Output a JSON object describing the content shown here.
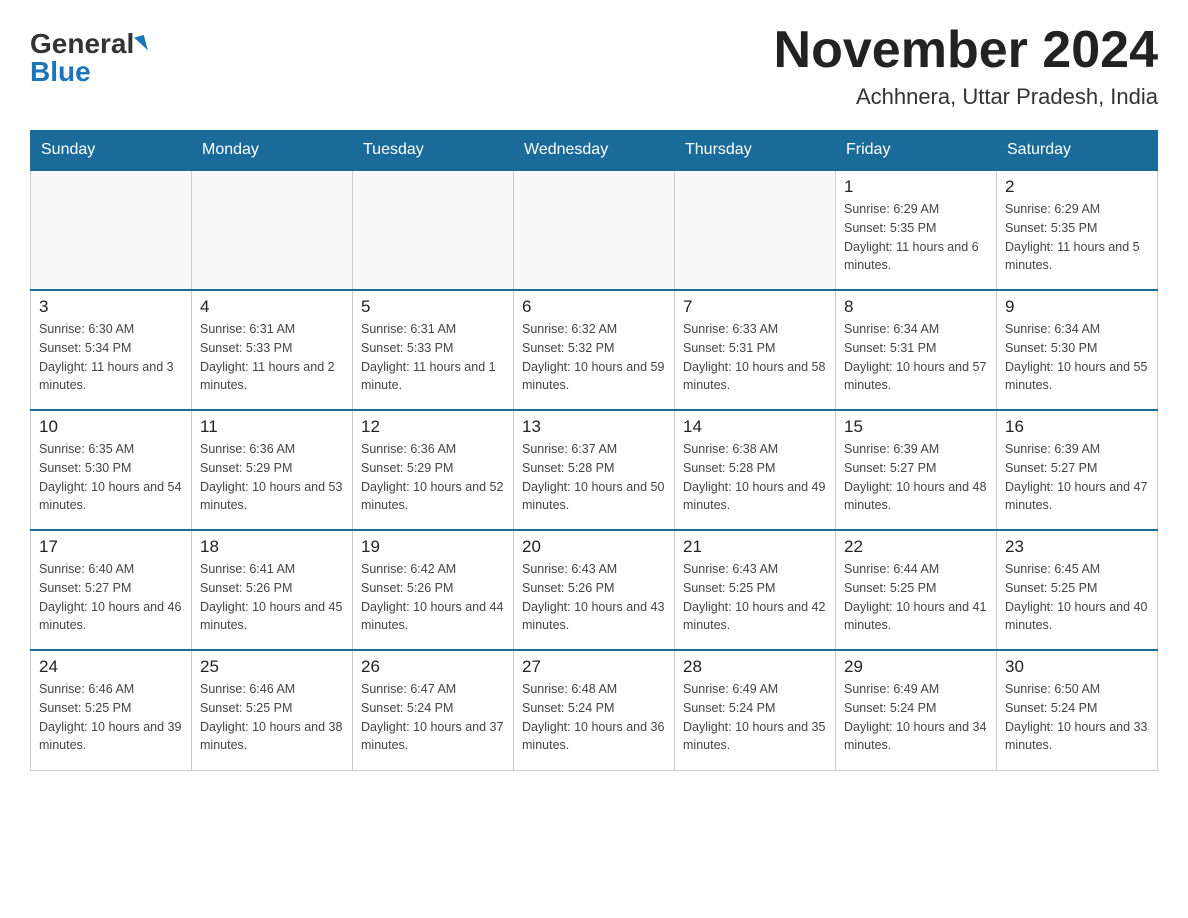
{
  "header": {
    "logo_general": "General",
    "logo_blue": "Blue",
    "month_title": "November 2024",
    "subtitle": "Achhnera, Uttar Pradesh, India"
  },
  "days_of_week": [
    "Sunday",
    "Monday",
    "Tuesday",
    "Wednesday",
    "Thursday",
    "Friday",
    "Saturday"
  ],
  "weeks": [
    [
      {
        "day": "",
        "info": ""
      },
      {
        "day": "",
        "info": ""
      },
      {
        "day": "",
        "info": ""
      },
      {
        "day": "",
        "info": ""
      },
      {
        "day": "",
        "info": ""
      },
      {
        "day": "1",
        "info": "Sunrise: 6:29 AM\nSunset: 5:35 PM\nDaylight: 11 hours and 6 minutes."
      },
      {
        "day": "2",
        "info": "Sunrise: 6:29 AM\nSunset: 5:35 PM\nDaylight: 11 hours and 5 minutes."
      }
    ],
    [
      {
        "day": "3",
        "info": "Sunrise: 6:30 AM\nSunset: 5:34 PM\nDaylight: 11 hours and 3 minutes."
      },
      {
        "day": "4",
        "info": "Sunrise: 6:31 AM\nSunset: 5:33 PM\nDaylight: 11 hours and 2 minutes."
      },
      {
        "day": "5",
        "info": "Sunrise: 6:31 AM\nSunset: 5:33 PM\nDaylight: 11 hours and 1 minute."
      },
      {
        "day": "6",
        "info": "Sunrise: 6:32 AM\nSunset: 5:32 PM\nDaylight: 10 hours and 59 minutes."
      },
      {
        "day": "7",
        "info": "Sunrise: 6:33 AM\nSunset: 5:31 PM\nDaylight: 10 hours and 58 minutes."
      },
      {
        "day": "8",
        "info": "Sunrise: 6:34 AM\nSunset: 5:31 PM\nDaylight: 10 hours and 57 minutes."
      },
      {
        "day": "9",
        "info": "Sunrise: 6:34 AM\nSunset: 5:30 PM\nDaylight: 10 hours and 55 minutes."
      }
    ],
    [
      {
        "day": "10",
        "info": "Sunrise: 6:35 AM\nSunset: 5:30 PM\nDaylight: 10 hours and 54 minutes."
      },
      {
        "day": "11",
        "info": "Sunrise: 6:36 AM\nSunset: 5:29 PM\nDaylight: 10 hours and 53 minutes."
      },
      {
        "day": "12",
        "info": "Sunrise: 6:36 AM\nSunset: 5:29 PM\nDaylight: 10 hours and 52 minutes."
      },
      {
        "day": "13",
        "info": "Sunrise: 6:37 AM\nSunset: 5:28 PM\nDaylight: 10 hours and 50 minutes."
      },
      {
        "day": "14",
        "info": "Sunrise: 6:38 AM\nSunset: 5:28 PM\nDaylight: 10 hours and 49 minutes."
      },
      {
        "day": "15",
        "info": "Sunrise: 6:39 AM\nSunset: 5:27 PM\nDaylight: 10 hours and 48 minutes."
      },
      {
        "day": "16",
        "info": "Sunrise: 6:39 AM\nSunset: 5:27 PM\nDaylight: 10 hours and 47 minutes."
      }
    ],
    [
      {
        "day": "17",
        "info": "Sunrise: 6:40 AM\nSunset: 5:27 PM\nDaylight: 10 hours and 46 minutes."
      },
      {
        "day": "18",
        "info": "Sunrise: 6:41 AM\nSunset: 5:26 PM\nDaylight: 10 hours and 45 minutes."
      },
      {
        "day": "19",
        "info": "Sunrise: 6:42 AM\nSunset: 5:26 PM\nDaylight: 10 hours and 44 minutes."
      },
      {
        "day": "20",
        "info": "Sunrise: 6:43 AM\nSunset: 5:26 PM\nDaylight: 10 hours and 43 minutes."
      },
      {
        "day": "21",
        "info": "Sunrise: 6:43 AM\nSunset: 5:25 PM\nDaylight: 10 hours and 42 minutes."
      },
      {
        "day": "22",
        "info": "Sunrise: 6:44 AM\nSunset: 5:25 PM\nDaylight: 10 hours and 41 minutes."
      },
      {
        "day": "23",
        "info": "Sunrise: 6:45 AM\nSunset: 5:25 PM\nDaylight: 10 hours and 40 minutes."
      }
    ],
    [
      {
        "day": "24",
        "info": "Sunrise: 6:46 AM\nSunset: 5:25 PM\nDaylight: 10 hours and 39 minutes."
      },
      {
        "day": "25",
        "info": "Sunrise: 6:46 AM\nSunset: 5:25 PM\nDaylight: 10 hours and 38 minutes."
      },
      {
        "day": "26",
        "info": "Sunrise: 6:47 AM\nSunset: 5:24 PM\nDaylight: 10 hours and 37 minutes."
      },
      {
        "day": "27",
        "info": "Sunrise: 6:48 AM\nSunset: 5:24 PM\nDaylight: 10 hours and 36 minutes."
      },
      {
        "day": "28",
        "info": "Sunrise: 6:49 AM\nSunset: 5:24 PM\nDaylight: 10 hours and 35 minutes."
      },
      {
        "day": "29",
        "info": "Sunrise: 6:49 AM\nSunset: 5:24 PM\nDaylight: 10 hours and 34 minutes."
      },
      {
        "day": "30",
        "info": "Sunrise: 6:50 AM\nSunset: 5:24 PM\nDaylight: 10 hours and 33 minutes."
      }
    ]
  ]
}
